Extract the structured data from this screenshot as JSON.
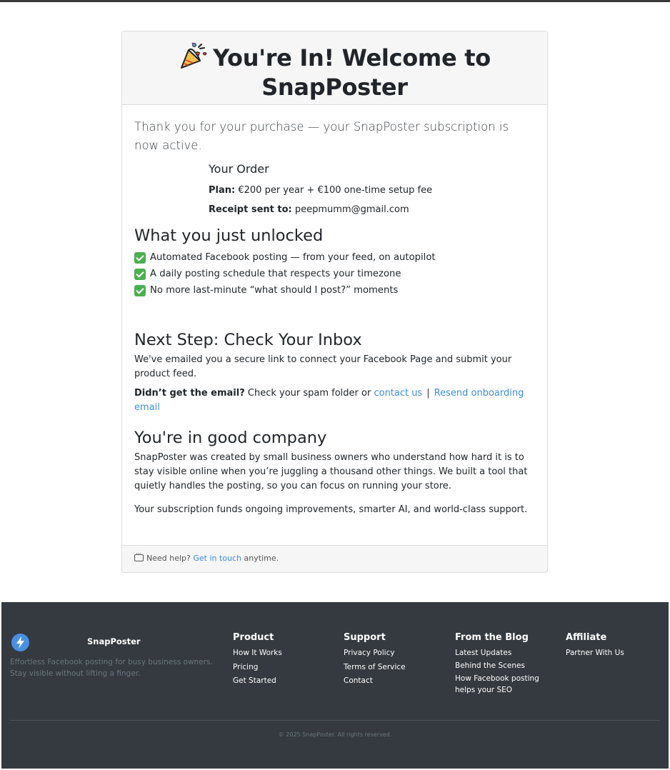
{
  "header": {
    "title_line1": "You're In! Welcome to",
    "title_line2": "SnapPoster"
  },
  "intro": "Thank you for your purchase — your SnapPoster subscription is now active.",
  "order": {
    "heading": "Your Order",
    "plan_label": "Plan:",
    "plan_value": " €200 per year + €100 one-time setup fee",
    "receipt_label": "Receipt sent to:",
    "receipt_value": " peepmumm@gmail.com"
  },
  "unlocked": {
    "heading": "What you just unlocked",
    "items": [
      "Automated Facebook posting — from your feed, on autopilot",
      "A daily posting schedule that respects your timezone",
      "No more last-minute “what should I post?” moments"
    ]
  },
  "next_step": {
    "heading": "Next Step: Check Your Inbox",
    "body": "We've emailed you a secure link to connect your Facebook Page and submit your product feed.",
    "question": "Didn’t get the email?",
    "hint": " Check your spam folder or ",
    "contact_link": "contact us",
    "separator": "|",
    "resend_link": "Resend onboarding email"
  },
  "company": {
    "heading": "You're in good company",
    "para1": "SnapPoster was created by small business owners who understand how hard it is to stay visible online when you’re juggling a thousand other things. We built a tool that quietly handles the posting, so you can focus on running your store.",
    "para2": "Your subscription funds ongoing improvements, smarter AI, and world-class support."
  },
  "help": {
    "prefix": "Need help? ",
    "link": "Get in touch",
    "suffix": " anytime."
  },
  "footer": {
    "brand": "SnapPoster",
    "tagline": "Effortless Facebook posting for busy business owners. Stay visible without lifting a finger.",
    "columns": [
      {
        "title": "Product",
        "links": [
          "How It Works",
          "Pricing",
          "Get Started"
        ]
      },
      {
        "title": "Support",
        "links": [
          "Privacy Policy",
          "Terms of Service",
          "Contact"
        ]
      },
      {
        "title": "From the Blog",
        "links": [
          "Latest Updates",
          "Behind the Scenes",
          "How Facebook posting helps your SEO"
        ]
      },
      {
        "title": "Affiliate",
        "links": [
          "Partner With Us"
        ]
      }
    ],
    "copyright": "© 2025 SnapPoster. All rights reserved."
  },
  "colors": {
    "link": "#3c8ddc",
    "check": "#4caf50",
    "footer_bg": "#343a40",
    "brand_icon": "#4a90e2"
  }
}
